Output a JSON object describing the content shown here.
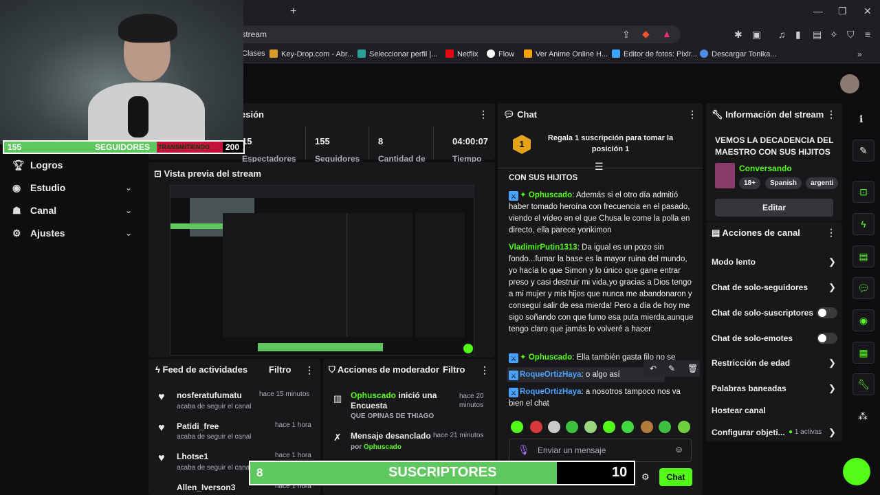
{
  "browser": {
    "url": "/stream",
    "bookmarks": [
      "Clases",
      "Key-Drop.com - Abr...",
      "Seleccionar perfil |...",
      "Netflix",
      "Flow",
      "Ver Anime Online H...",
      "Editor de fotos: Pixlr...",
      "Descargar Tonika..."
    ],
    "colors": {
      "netflix": "#e50914",
      "flow": "#ffffff",
      "anime": "#f4a300"
    }
  },
  "overlay": {
    "followers_current": "155",
    "followers_label": "SEGUIDORES",
    "followers_goal": "200",
    "live_badge": "TRANSMITIENDO",
    "subs_current": "8",
    "subs_label": "SUSCRIPTORES",
    "subs_goal": "10",
    "subs_progress": 0.8,
    "followers_progress": 0.775
  },
  "sidebar": {
    "items": [
      {
        "label": "Logros",
        "icon": "trophy-icon"
      },
      {
        "label": "Estudio",
        "icon": "camera-icon"
      },
      {
        "label": "Canal",
        "icon": "users-icon"
      },
      {
        "label": "Ajustes",
        "icon": "gear-icon"
      }
    ]
  },
  "session": {
    "title_partial": "esión",
    "stats": [
      {
        "value": "15",
        "label": "Espectadores"
      },
      {
        "value": "155",
        "label": "Seguidores"
      },
      {
        "value": "8",
        "label": "Cantidad de"
      },
      {
        "value": "04:00:07",
        "label": "Tiempo"
      }
    ]
  },
  "preview": {
    "title": "Vista previa del stream"
  },
  "feed": {
    "title": "Feed de actividades",
    "filter": "Filtro",
    "items": [
      {
        "name": "nosferatufumatu",
        "action": "acaba de seguir el canal",
        "time": "hace 15 minutos"
      },
      {
        "name": "Patidi_free",
        "action": "acaba de seguir el canal",
        "time": "hace 1 hora"
      },
      {
        "name": "Lhotse1",
        "action": "acaba de seguir el canal",
        "time": "hace 1 hora"
      },
      {
        "name": "Allen_Iverson3",
        "action": "",
        "time": "hace 1 hora"
      }
    ]
  },
  "modactions": {
    "title": "Acciones de moderador",
    "filter": "Filtro",
    "items": [
      {
        "user": "Ophuscado",
        "action": "inició una Encuesta",
        "detail": "QUE OPINAS DE THIAGO",
        "time": "hace 20 minutos"
      },
      {
        "user": "",
        "action": "Mensaje desanclado",
        "detail_prefix": "por",
        "detail": "Ophuscado",
        "time": "hace 21 minutos"
      }
    ]
  },
  "chat": {
    "title": "Chat",
    "gift_text": "Regala 1 suscripción para tomar la posición 1",
    "gift_rank": "1",
    "pinned_tail": "CON SUS HIJITOS",
    "messages": [
      {
        "user": "Ophuscado",
        "text": "Además si el otro día admitió haber tomado heroína con frecuencia en el pasado, viendo el vídeo en el que Chusa le come la polla en directo, ella parece yonkimon"
      },
      {
        "user": "VladimirPutin1313",
        "text": "Da igual es un pozo sin fondo...fumar la base es la mayor ruina del mundo, yo hacía lo que Simon y lo único que gane entrar preso y casi destruir mi vida,yo gracias a Dios tengo a mi mujer y mis hijos que nunca me abandonaron y conseguí salir de esa mierda! Pero a día de hoy me sigo soñando con que fumo esa puta mierda,aunque tengo claro que jamás lo volveré a hacer"
      },
      {
        "user": "Ophuscado",
        "text": "Ella también gasta filo no se"
      },
      {
        "user": "RoqueOrtizHaya",
        "text": "o algo así"
      },
      {
        "user": "RoqueOrtizHaya",
        "text": "a nosotros tampoco nos va bien el chat"
      }
    ],
    "placeholder": "Enviar un mensaje",
    "send_label": "Chat",
    "user_colors": {
      "Ophuscado": "#53fc18",
      "VladimirPutin1313": "#53fc18",
      "RoqueOrtizHaya": "#4aa4ff"
    }
  },
  "streaminfo": {
    "title": "Información del stream",
    "stream_title": "VEMOS LA DECADENCIA DEL MAESTRO CON SUS HIJITOS",
    "category": "Conversando",
    "tags": [
      "18+",
      "Spanish",
      "argenti"
    ],
    "edit_label": "Editar"
  },
  "channelactions": {
    "title": "Acciones de canal",
    "rows": [
      {
        "label": "Modo lento",
        "kind": "chevron"
      },
      {
        "label": "Chat de solo-seguidores",
        "kind": "chevron"
      },
      {
        "label": "Chat de solo-suscriptores",
        "kind": "toggle"
      },
      {
        "label": "Chat de solo-emotes",
        "kind": "toggle"
      },
      {
        "label": "Restricción de edad",
        "kind": "chevron"
      },
      {
        "label": "Palabras baneadas",
        "kind": "chevron"
      },
      {
        "label": "Hostear canal",
        "kind": "none"
      },
      {
        "label": "Configurar objeti...",
        "kind": "chevron"
      }
    ],
    "active_count": "1 activas"
  }
}
